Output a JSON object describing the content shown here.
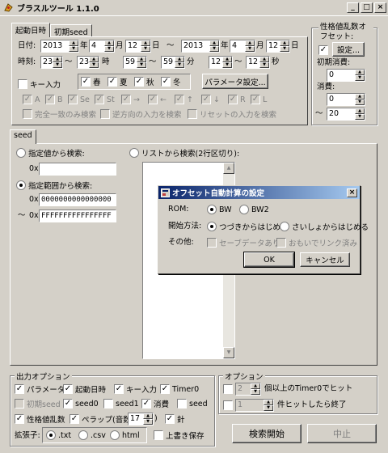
{
  "window": {
    "title": "ブラスルツール 1.1.0",
    "min": "_",
    "max": "□",
    "close": "×"
  },
  "tabs": {
    "start_time": "起動日時",
    "initial_seed": "初期seed"
  },
  "date": {
    "label": "日付:",
    "y1": "2013",
    "m1": "4",
    "d1": "12",
    "y2": "2013",
    "m2": "4",
    "d2": "12",
    "year": "年",
    "month": "月",
    "day": "日",
    "tilde": "～"
  },
  "time": {
    "label": "時刻:",
    "h1": "23",
    "h2": "23",
    "hour": "時",
    "mi1": "59",
    "mi2": "59",
    "minute": "分",
    "s1": "12",
    "s2": "12",
    "second": "秒",
    "tilde": "～"
  },
  "keys": {
    "key_input": "キー入力",
    "spring": "春",
    "summer": "夏",
    "autumn": "秋",
    "winter": "冬",
    "params_button": "パラメータ設定...",
    "buttons": [
      "A",
      "B",
      "Se",
      "St",
      "→",
      "←",
      "↑",
      "↓",
      "R",
      "L"
    ],
    "exact_match": "完全一致のみ検索",
    "reverse_search": "逆方向の入力を検索",
    "reset_search": "リセットの入力を検索"
  },
  "offset": {
    "title": "性格値乱数オフセット:",
    "set_button": "設定...",
    "initial_consume": "初期消費:",
    "initial_value": "0",
    "consume": "消費:",
    "c1": "0",
    "c2": "20",
    "tilde": "～"
  },
  "seed": {
    "tab": "seed",
    "specified": "指定値から検索:",
    "prefix": "0x",
    "range": "指定範囲から検索:",
    "from": "0000000000000000",
    "to": "FFFFFFFFFFFFFFFF",
    "tilde": "～",
    "list": "リストから検索(2行区切り):"
  },
  "dialog": {
    "title": "オフセット自動計算の設定",
    "rom_label": "ROM:",
    "bw": "BW",
    "bw2": "BW2",
    "start_label": "開始方法:",
    "start_new": "つづきからはじめる",
    "start_fresh": "さいしょからはじめる",
    "other_label": "その他:",
    "save_data": "セーブデータあり",
    "memory_link": "おもいでリンク済み",
    "ok": "OK",
    "cancel": "キャンセル"
  },
  "output": {
    "title": "出力オプション",
    "parameter": "パラメータ",
    "start_time": "起動日時",
    "key_input": "キー入力",
    "timer0": "Timer0",
    "initial_seed": "初期seed",
    "seed0": "seed0",
    "seed1": "seed1",
    "consume": "消費",
    "seed": "seed",
    "personality": "性格値乱数",
    "pelappu": "ペラップ(音数:",
    "pelappu_val": "17",
    "close_paren": ")",
    "needle": "針",
    "ext_label": "拡張子:",
    "txt": ".txt",
    "csv": ".csv",
    "html": "html",
    "overwrite": "上書き保存"
  },
  "options": {
    "title": "オプション",
    "timer0_val": "2",
    "timer0_text": "個以上のTimer0でヒット",
    "hits_val": "1",
    "hits_text": "件ヒットしたら終了"
  },
  "actions": {
    "search": "検索開始",
    "stop": "中止"
  },
  "colors": {
    "face": "#d4d0c8",
    "title_from": "#0a246a",
    "title_to": "#a6caf0"
  }
}
